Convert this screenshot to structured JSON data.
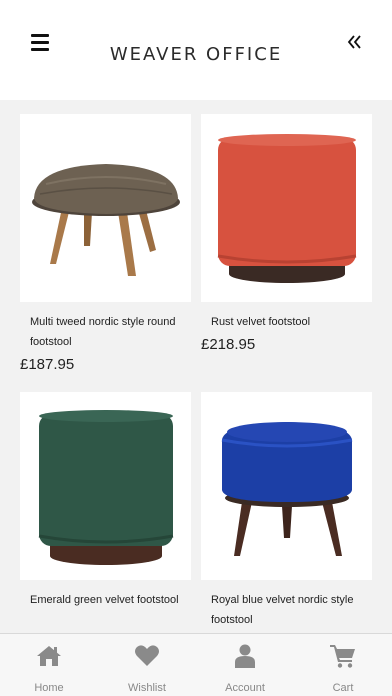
{
  "header": {
    "brand": "WEAVER OFFICE",
    "menu_icon": "hamburger-menu-icon",
    "collapse_icon": "double-chevron-left-icon"
  },
  "products": [
    {
      "name": "Multi tweed nordic style round footstool",
      "price": "£187.95",
      "image": "grey-tweed-round-footstool"
    },
    {
      "name": "Rust velvet footstool",
      "price": "£218.95",
      "image": "rust-velvet-footstool"
    },
    {
      "name": "Emerald green velvet footstool",
      "price": "",
      "image": "emerald-velvet-footstool"
    },
    {
      "name": "Royal blue velvet nordic style footstool",
      "price": "",
      "image": "royal-blue-velvet-footstool"
    }
  ],
  "tabs": [
    {
      "label": "Home",
      "icon": "home-icon"
    },
    {
      "label": "Wishlist",
      "icon": "heart-icon"
    },
    {
      "label": "Account",
      "icon": "user-icon"
    },
    {
      "label": "Cart",
      "icon": "cart-icon"
    }
  ],
  "colors": {
    "rust": "#d7523f",
    "emerald": "#2f5747",
    "royal_blue": "#1c3fa6",
    "tweed": "#6d6152",
    "wood": "#a9794a",
    "dark_wood": "#4a2c22",
    "tab_icon": "#8a8a8a"
  }
}
